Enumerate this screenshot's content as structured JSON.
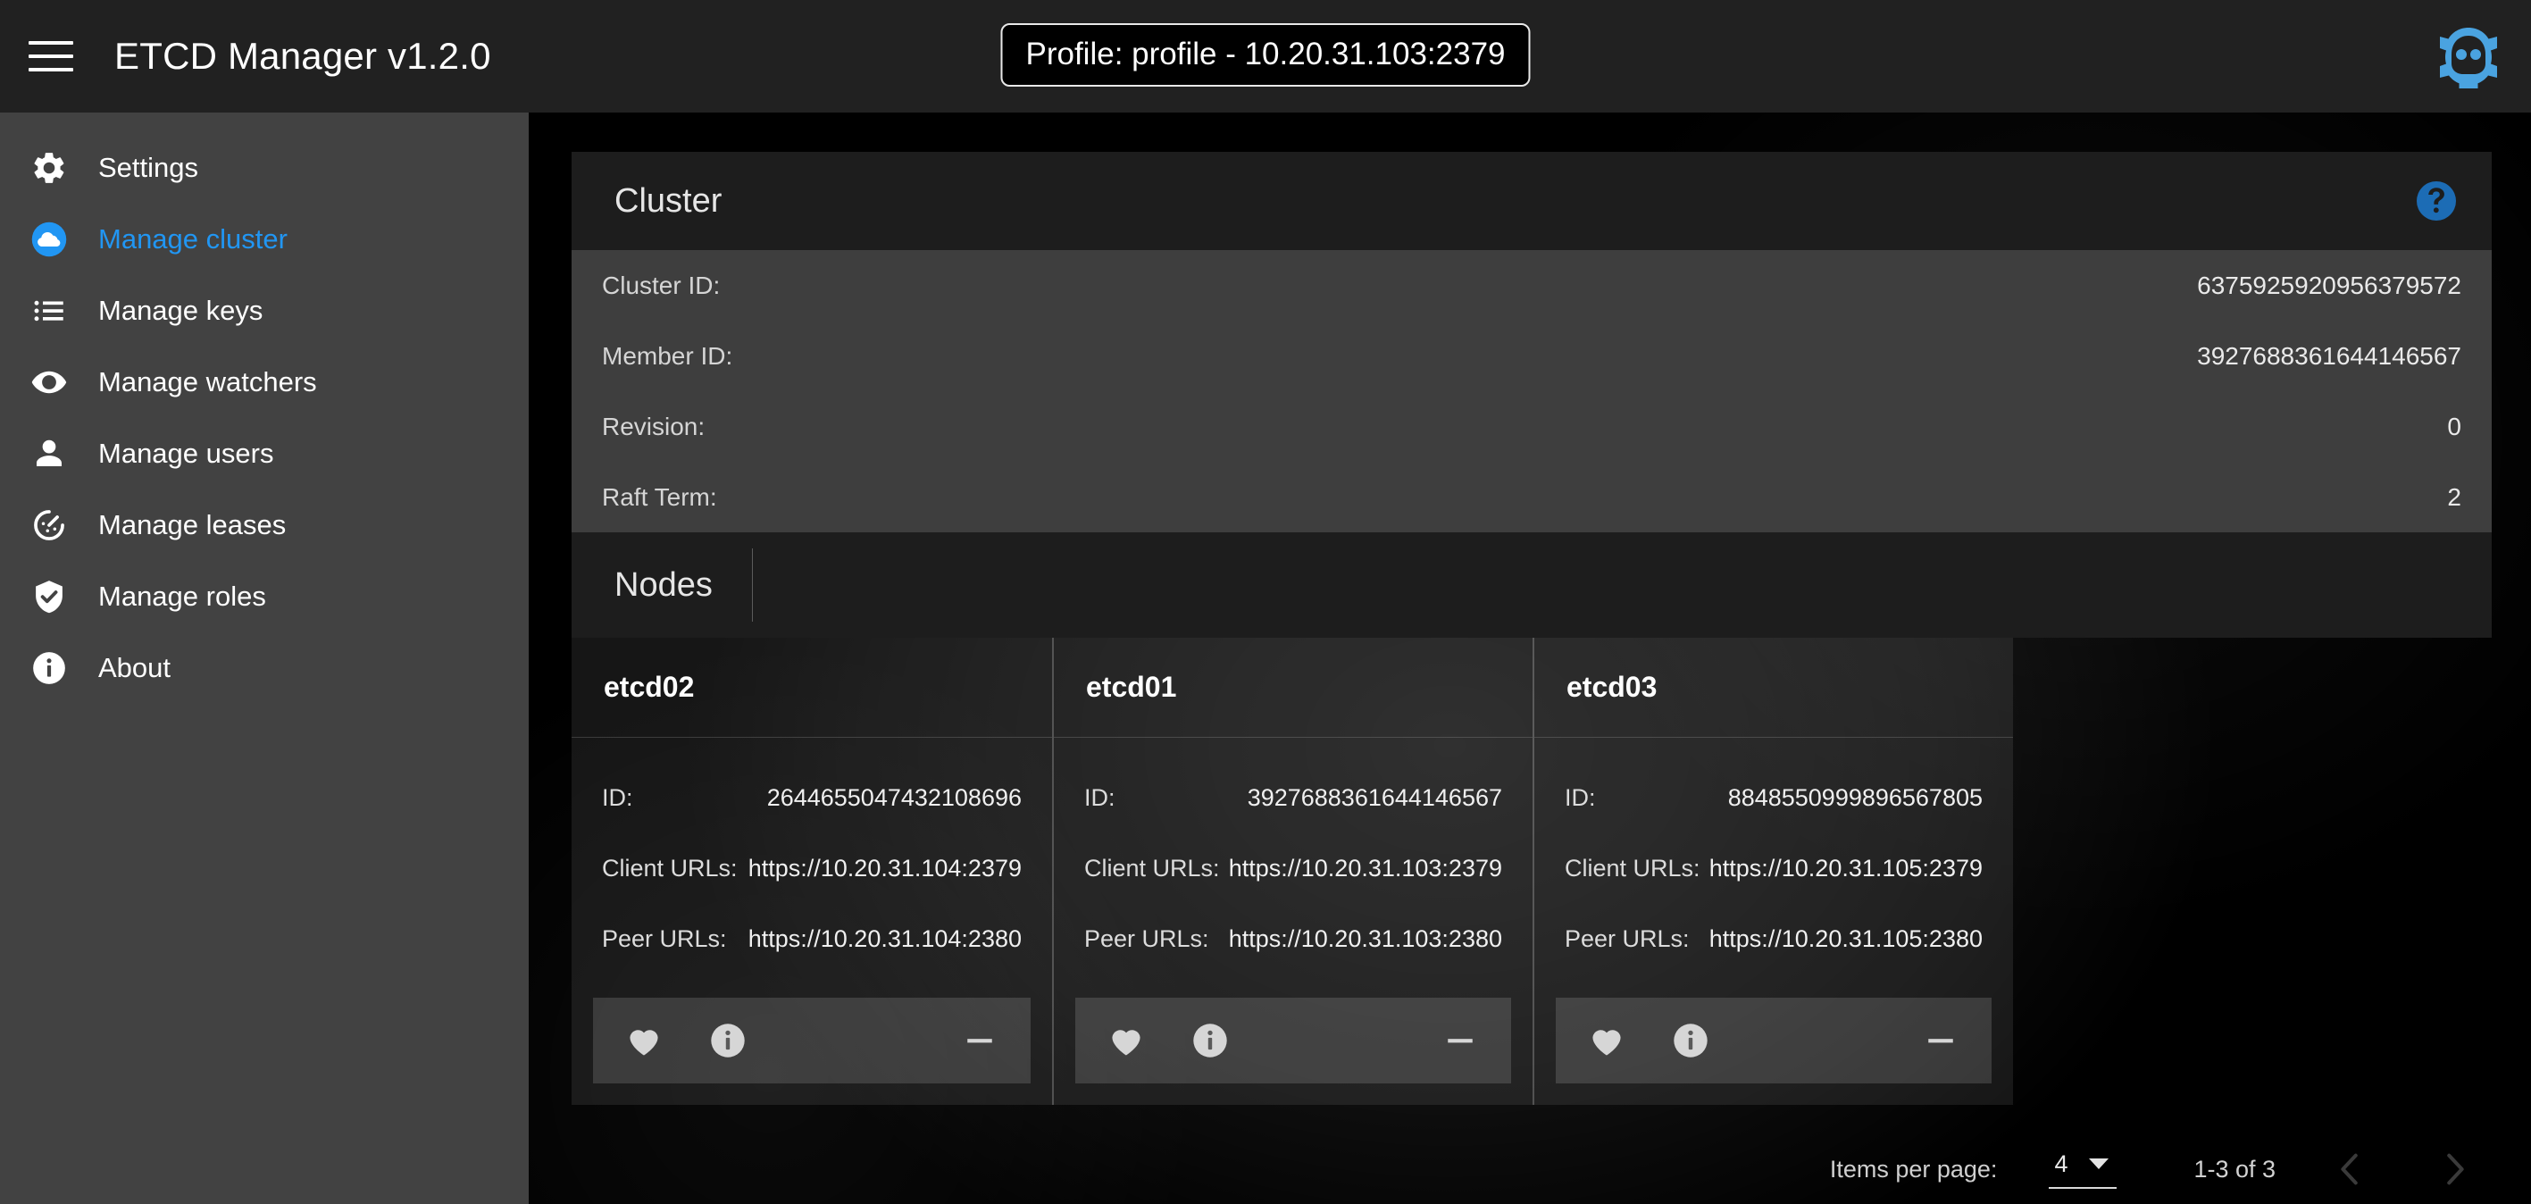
{
  "header": {
    "menu_icon": "hamburger-menu-icon",
    "app_title": "ETCD Manager v1.2.0",
    "profile_badge": "Profile: profile - 10.20.31.103:2379",
    "logo_icon": "robot-gear-logo-icon",
    "accent_blue": "#2196f3",
    "logo_blue": "#4aa3e0"
  },
  "sidebar": {
    "items": [
      {
        "label": "Settings",
        "icon": "gear-icon",
        "active": false
      },
      {
        "label": "Manage cluster",
        "icon": "cloud-icon",
        "active": true
      },
      {
        "label": "Manage keys",
        "icon": "list-icon",
        "active": false
      },
      {
        "label": "Manage watchers",
        "icon": "eye-icon",
        "active": false
      },
      {
        "label": "Manage users",
        "icon": "person-icon",
        "active": false
      },
      {
        "label": "Manage leases",
        "icon": "timer-icon",
        "active": false
      },
      {
        "label": "Manage roles",
        "icon": "shield-check-icon",
        "active": false
      },
      {
        "label": "About",
        "icon": "info-icon",
        "active": false
      }
    ]
  },
  "cluster": {
    "title": "Cluster",
    "help_icon": "help-circle-icon",
    "rows": [
      {
        "key": "Cluster ID:",
        "value": "6375925920956379572"
      },
      {
        "key": "Member ID:",
        "value": "3927688361644146567"
      },
      {
        "key": "Revision:",
        "value": "0"
      },
      {
        "key": "Raft Term:",
        "value": "2"
      }
    ]
  },
  "nodes": {
    "title": "Nodes",
    "field_labels": {
      "id": "ID:",
      "client": "Client URLs:",
      "peer": "Peer URLs:"
    },
    "action_icons": [
      "heart-icon",
      "info-circle-icon",
      "minus-remove-icon"
    ],
    "cards": [
      {
        "name": "etcd02",
        "id": "2644655047432108696",
        "client_urls": "https://10.20.31.104:2379",
        "peer_urls": "https://10.20.31.104:2380"
      },
      {
        "name": "etcd01",
        "id": "3927688361644146567",
        "client_urls": "https://10.20.31.103:2379",
        "peer_urls": "https://10.20.31.103:2380"
      },
      {
        "name": "etcd03",
        "id": "8848550999896567805",
        "client_urls": "https://10.20.31.105:2379",
        "peer_urls": "https://10.20.31.105:2380"
      }
    ]
  },
  "paginator": {
    "items_per_page_label": "Items per page:",
    "items_per_page_value": "4",
    "range_label": "1-3 of 3",
    "prev_icon": "chevron-left-icon",
    "next_icon": "chevron-right-icon"
  }
}
